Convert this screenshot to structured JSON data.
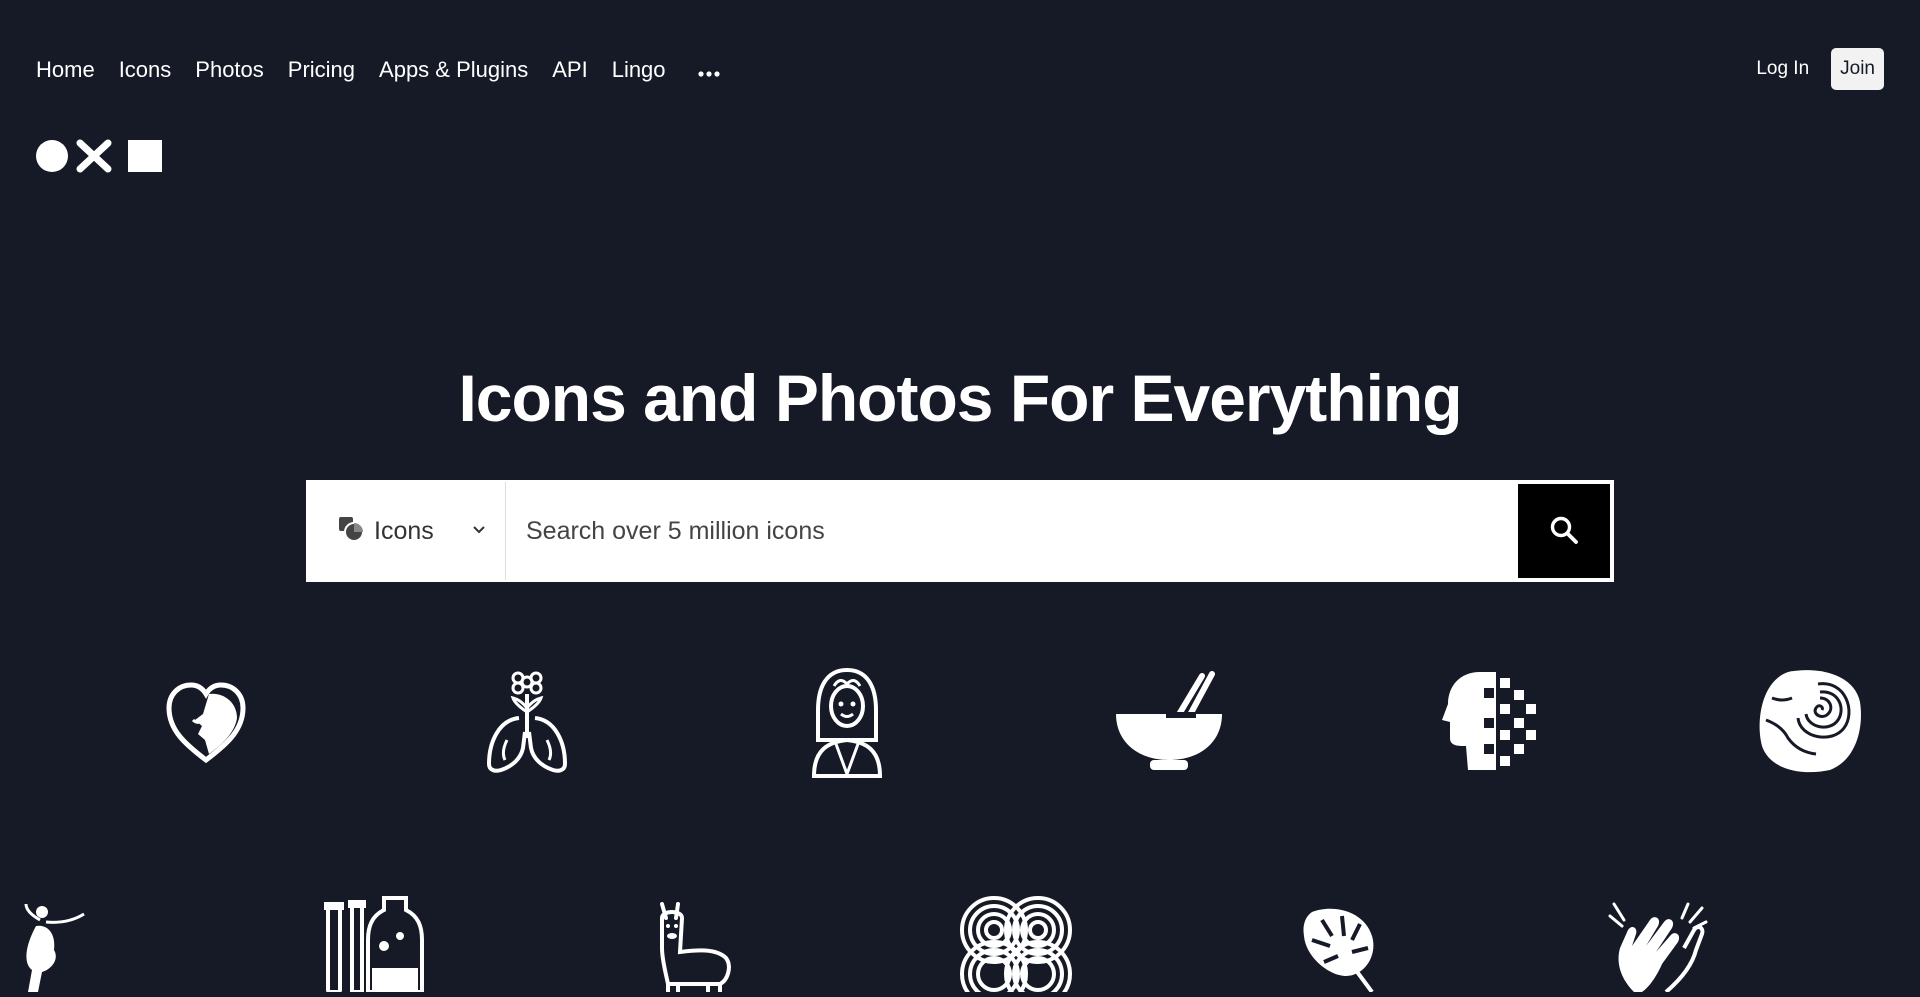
{
  "nav": {
    "items": [
      {
        "label": "Home"
      },
      {
        "label": "Icons"
      },
      {
        "label": "Photos"
      },
      {
        "label": "Pricing"
      },
      {
        "label": "Apps & Plugins"
      },
      {
        "label": "API"
      },
      {
        "label": "Lingo"
      }
    ],
    "more_icon": "more-horizontal-icon"
  },
  "auth": {
    "login_label": "Log In",
    "join_label": "Join"
  },
  "logo": {
    "icon": "noun-project-logo"
  },
  "hero": {
    "title": "Icons and Photos For Everything"
  },
  "search": {
    "type_label": "Icons",
    "type_icon": "icons-category-icon",
    "placeholder": "Search over 5 million icons",
    "value": "",
    "button_icon": "search-icon"
  },
  "showcase": {
    "row1": [
      "heart-face-icon",
      "lungs-flower-icon",
      "woman-portrait-icon",
      "bowl-chopsticks-icon",
      "pixel-head-icon",
      "fossil-stone-icon"
    ],
    "row2": [
      "dancer-icon",
      "lab-bottles-icon",
      "llama-icon",
      "celtic-knot-icon",
      "monstera-leaf-icon",
      "clapping-hands-icon"
    ]
  },
  "colors": {
    "background": "#161a26",
    "foreground": "#ffffff",
    "search_button": "#000000"
  }
}
